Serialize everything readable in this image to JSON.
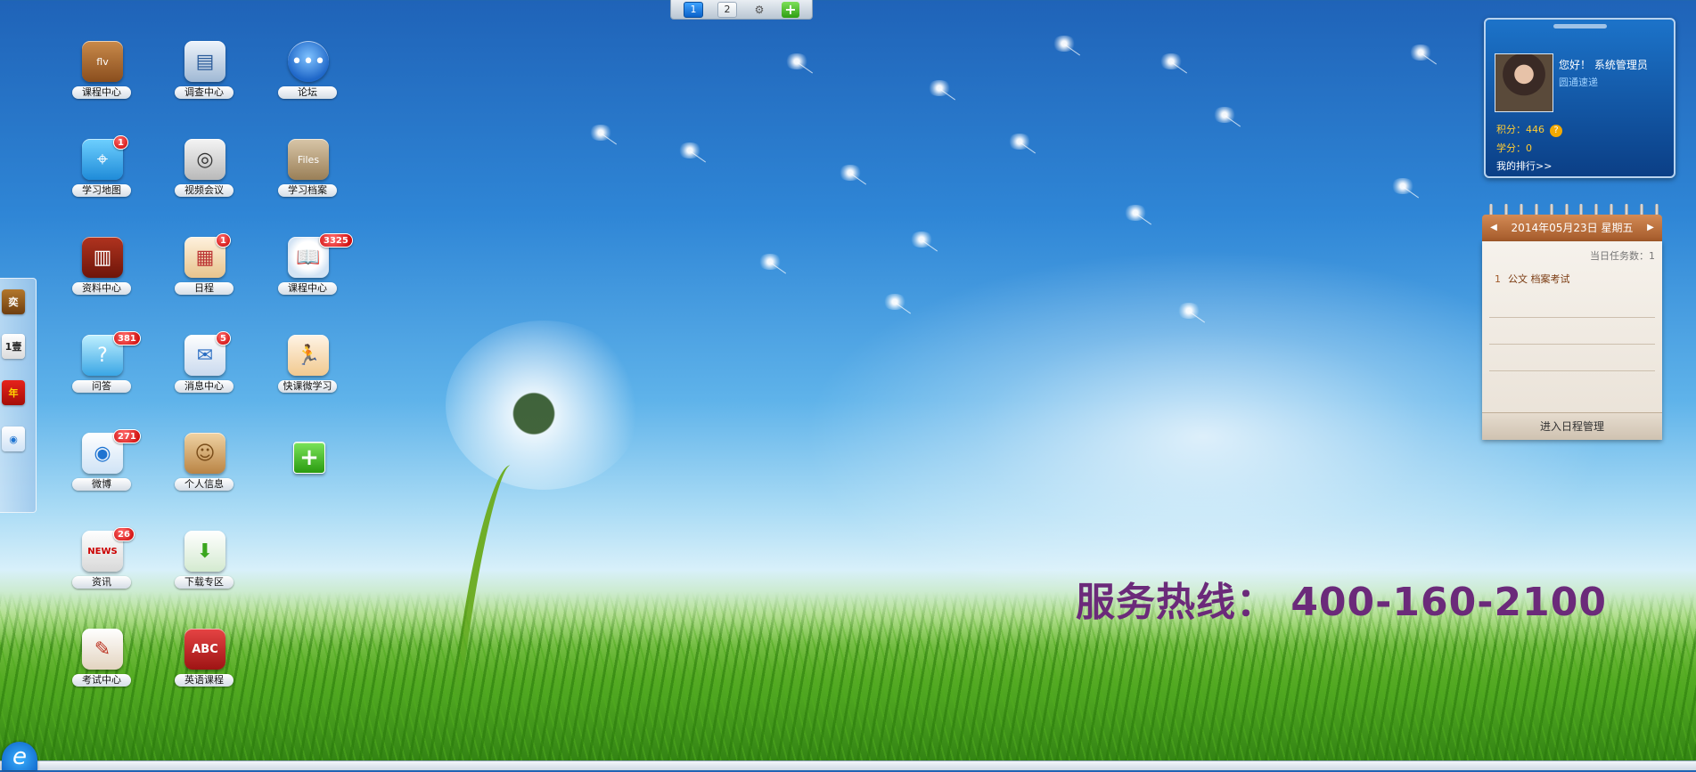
{
  "pager": {
    "pages": [
      "1",
      "2"
    ],
    "active_index": 0,
    "settings_icon": "gear-icon",
    "add_icon": "plus-icon"
  },
  "desktop": {
    "icons": [
      {
        "label": "课程中心",
        "icon": "flv-url-media-icon",
        "badge": ""
      },
      {
        "label": "调查中心",
        "icon": "clipboard-icon",
        "badge": ""
      },
      {
        "label": "论坛",
        "icon": "speech-bubble-icon",
        "badge": ""
      },
      {
        "label": "学习地图",
        "icon": "map-icon",
        "badge": "1"
      },
      {
        "label": "视频会议",
        "icon": "webcam-icon",
        "badge": ""
      },
      {
        "label": "学习档案",
        "icon": "files-icon",
        "badge": ""
      },
      {
        "label": "资料中心",
        "icon": "bookshelf-icon",
        "badge": ""
      },
      {
        "label": "日程",
        "icon": "calendar-icon",
        "badge": "1"
      },
      {
        "label": "课程中心",
        "icon": "open-book-icon",
        "badge": "3325"
      },
      {
        "label": "问答",
        "icon": "qa-bubbles-icon",
        "badge": "381"
      },
      {
        "label": "消息中心",
        "icon": "envelope-icon",
        "badge": "5"
      },
      {
        "label": "快课微学习",
        "icon": "runner-icon",
        "badge": ""
      },
      {
        "label": "微博",
        "icon": "weibo-icon",
        "badge": "271"
      },
      {
        "label": "个人信息",
        "icon": "contact-book-icon",
        "badge": ""
      },
      {
        "label": "资讯",
        "icon": "newspaper-icon",
        "badge": "26"
      },
      {
        "label": "下载专区",
        "icon": "download-arrow-icon",
        "badge": ""
      },
      {
        "label": "考试中心",
        "icon": "exam-paper-icon",
        "badge": ""
      },
      {
        "label": "英语课程",
        "icon": "abc-book-icon",
        "badge": ""
      }
    ],
    "add_app_icon": "plus-icon",
    "tile_glyphs": {
      "news": "NEWS",
      "abc": "ABC",
      "files": "Files",
      "flv": "flv"
    }
  },
  "dock": {
    "items": [
      {
        "icon": "box-icon",
        "text": "奕"
      },
      {
        "icon": "calendar-day-icon",
        "text": "1壹"
      },
      {
        "icon": "fortune-icon",
        "text": "年"
      },
      {
        "icon": "weibo-icon",
        "text": ""
      }
    ]
  },
  "user": {
    "greeting": "您好！ 系统管理员",
    "link": "圆通速递",
    "points_label": "积分：446",
    "credits_label": "学分：0",
    "rank_link": "我的排行>>",
    "help_icon": "question-icon"
  },
  "calendar": {
    "date_text": "2014年05月23日 星期五",
    "task_count_label": "当日任务数：1",
    "tasks": [
      {
        "num": "1",
        "text": "公文 档案考试"
      }
    ],
    "manage_link": "进入日程管理"
  },
  "hotline": "服务热线： 400-160-2100",
  "colors": {
    "hotline": "#6b2a7a",
    "badge": "#c80000",
    "user_card": "#0b3f86",
    "calendar_head": "#a45a2a"
  }
}
